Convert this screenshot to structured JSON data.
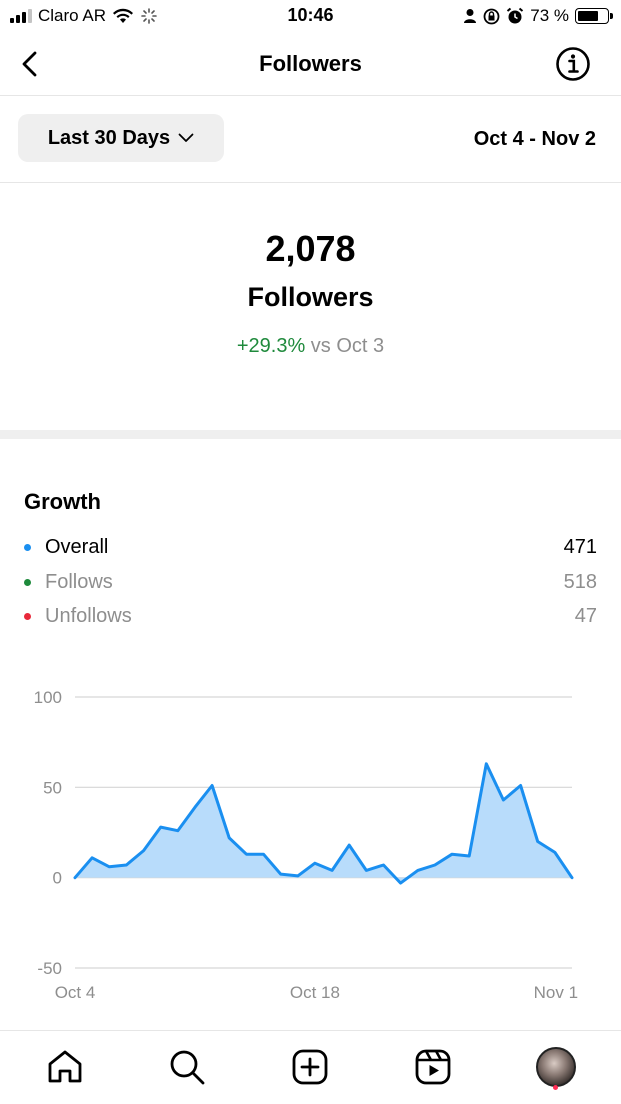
{
  "status_bar": {
    "carrier": "Claro AR",
    "time": "10:46",
    "battery": "73 %",
    "battery_level": 0.73,
    "icons": [
      "signal-icon",
      "wifi-icon",
      "loading-icon",
      "person-icon",
      "rotation-lock-icon",
      "alarm-icon",
      "battery-icon"
    ]
  },
  "header": {
    "title": "Followers",
    "back_icon": "chevron-left-icon",
    "info_icon": "info-icon"
  },
  "filter": {
    "range_label": "Last 30 Days",
    "date_range": "Oct 4 - Nov 2"
  },
  "summary": {
    "count": "2,078",
    "label": "Followers",
    "change": "+29.3%",
    "compare": "vs Oct 3"
  },
  "growth": {
    "title": "Growth",
    "rows": [
      {
        "label": "Overall",
        "value": "471",
        "color": "#1a8ff0"
      },
      {
        "label": "Follows",
        "value": "518",
        "color": "#1e8a3c"
      },
      {
        "label": "Unfollows",
        "value": "47",
        "color": "#e8283a"
      }
    ]
  },
  "chart_data": {
    "type": "area",
    "title": "",
    "xlabel": "",
    "ylabel": "",
    "ylim": [
      -50,
      100
    ],
    "y_ticks": [
      "100",
      "50",
      "0",
      "-50"
    ],
    "y_tick_values": [
      100,
      50,
      0,
      -50
    ],
    "x_tick_labels": [
      "Oct 4",
      "Oct 18",
      "Nov 1"
    ],
    "x": [
      "Oct 4",
      "Oct 5",
      "Oct 6",
      "Oct 7",
      "Oct 8",
      "Oct 9",
      "Oct 10",
      "Oct 11",
      "Oct 12",
      "Oct 13",
      "Oct 14",
      "Oct 15",
      "Oct 16",
      "Oct 17",
      "Oct 18",
      "Oct 19",
      "Oct 20",
      "Oct 21",
      "Oct 22",
      "Oct 23",
      "Oct 24",
      "Oct 25",
      "Oct 26",
      "Oct 27",
      "Oct 28",
      "Oct 29",
      "Oct 30",
      "Oct 31",
      "Nov 1",
      "Nov 2"
    ],
    "series": [
      {
        "color": "#1a8ff0",
        "fill": "#b8dcfb",
        "values": [
          0,
          11,
          6,
          7,
          15,
          28,
          26,
          39,
          51,
          22,
          13,
          13,
          2,
          1,
          8,
          4,
          18,
          4,
          7,
          -3,
          4,
          7,
          13,
          12,
          63,
          43,
          51,
          20,
          14,
          0
        ]
      }
    ],
    "grid": true,
    "legend": "none"
  },
  "tab_bar": {
    "items": [
      {
        "name": "home-icon"
      },
      {
        "name": "search-icon"
      },
      {
        "name": "create-icon"
      },
      {
        "name": "reels-icon"
      },
      {
        "name": "profile-avatar"
      }
    ]
  }
}
